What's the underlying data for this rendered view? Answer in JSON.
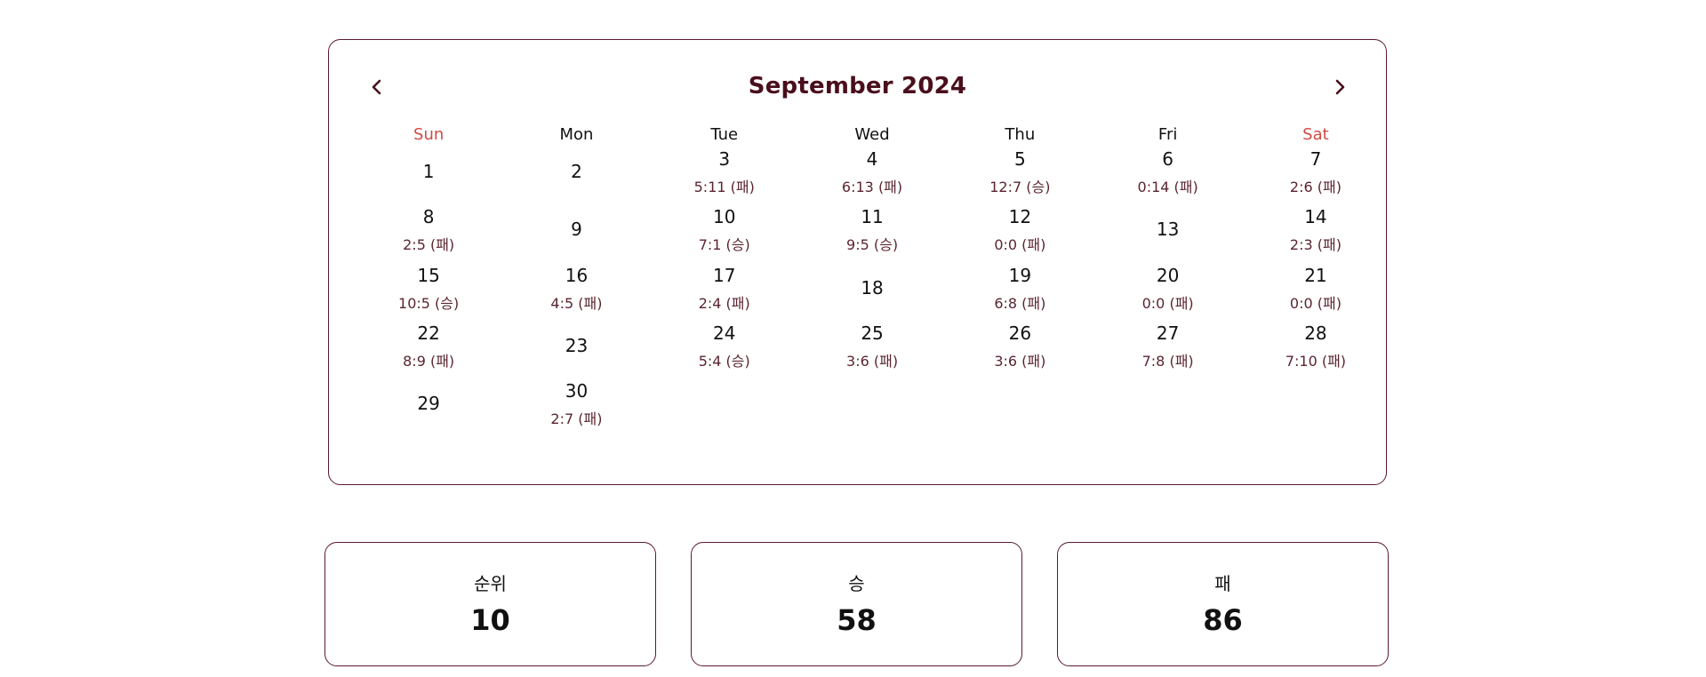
{
  "calendar": {
    "title": "September 2024",
    "prev_label": "previous month",
    "next_label": "next month",
    "weekdays": [
      "Sun",
      "Mon",
      "Tue",
      "Wed",
      "Thu",
      "Fri",
      "Sat"
    ],
    "weekend_color": "#d24a45",
    "days": [
      {
        "day": "1",
        "score": ""
      },
      {
        "day": "2",
        "score": ""
      },
      {
        "day": "3",
        "score": "5:11 (패)"
      },
      {
        "day": "4",
        "score": "6:13 (패)"
      },
      {
        "day": "5",
        "score": "12:7 (승)"
      },
      {
        "day": "6",
        "score": "0:14 (패)"
      },
      {
        "day": "7",
        "score": "2:6 (패)"
      },
      {
        "day": "8",
        "score": "2:5 (패)"
      },
      {
        "day": "9",
        "score": ""
      },
      {
        "day": "10",
        "score": "7:1 (승)"
      },
      {
        "day": "11",
        "score": "9:5 (승)"
      },
      {
        "day": "12",
        "score": "0:0 (패)"
      },
      {
        "day": "13",
        "score": ""
      },
      {
        "day": "14",
        "score": "2:3 (패)"
      },
      {
        "day": "15",
        "score": "10:5 (승)"
      },
      {
        "day": "16",
        "score": "4:5 (패)"
      },
      {
        "day": "17",
        "score": "2:4 (패)"
      },
      {
        "day": "18",
        "score": ""
      },
      {
        "day": "19",
        "score": "6:8 (패)"
      },
      {
        "day": "20",
        "score": "0:0 (패)"
      },
      {
        "day": "21",
        "score": "0:0 (패)"
      },
      {
        "day": "22",
        "score": "8:9 (패)"
      },
      {
        "day": "23",
        "score": ""
      },
      {
        "day": "24",
        "score": "5:4 (승)"
      },
      {
        "day": "25",
        "score": "3:6 (패)"
      },
      {
        "day": "26",
        "score": "3:6 (패)"
      },
      {
        "day": "27",
        "score": "7:8 (패)"
      },
      {
        "day": "28",
        "score": "7:10 (패)"
      },
      {
        "day": "29",
        "score": ""
      },
      {
        "day": "30",
        "score": "2:7 (패)"
      }
    ]
  },
  "stats": {
    "rank_label": "순위",
    "rank_value": "10",
    "wins_label": "승",
    "wins_value": "58",
    "losses_label": "패",
    "losses_value": "86"
  },
  "colors": {
    "accent": "#4a0f1c",
    "border": "#5a1a2b",
    "weekend": "#d24a45"
  },
  "icons": {
    "prev": "chevron-left-icon",
    "next": "chevron-right-icon"
  }
}
